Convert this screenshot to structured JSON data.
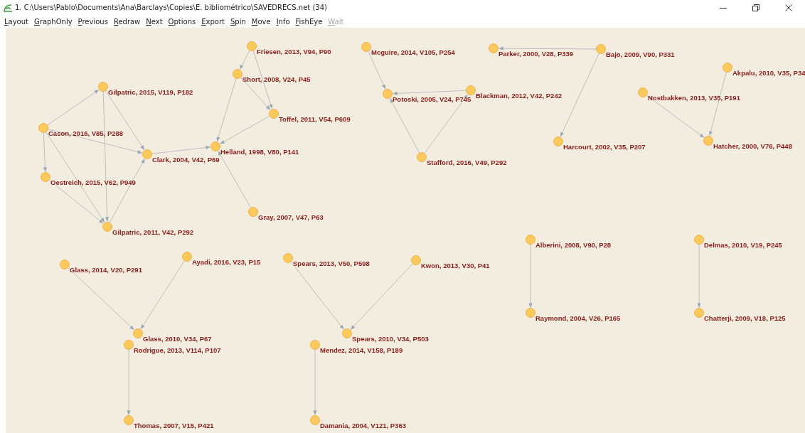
{
  "window": {
    "title": "1. C:\\Users\\Pablo\\Documents\\Ana\\Barclays\\Copies\\E. bibliométrico\\SAVEDRECS.net (34)"
  },
  "menu": [
    {
      "label": "Layout",
      "disabled": false
    },
    {
      "label": "GraphOnly",
      "disabled": false
    },
    {
      "label": "Previous",
      "disabled": false
    },
    {
      "label": "Redraw",
      "disabled": false
    },
    {
      "label": "Next",
      "disabled": false
    },
    {
      "label": "Options",
      "disabled": false
    },
    {
      "label": "Export",
      "disabled": false
    },
    {
      "label": "Spin",
      "disabled": false
    },
    {
      "label": "Move",
      "disabled": false
    },
    {
      "label": "Info",
      "disabled": false
    },
    {
      "label": "FishEye",
      "disabled": false
    },
    {
      "label": "Wait",
      "disabled": true
    }
  ],
  "graph": {
    "nodes": [
      {
        "label": "Friesen, 2013, V94, P90"
      },
      {
        "label": "Short, 2008, V24, P45"
      },
      {
        "label": "Gilpatric, 2015, V119, P182"
      },
      {
        "label": "Toffel, 2011, V54, P609"
      },
      {
        "label": "Cason, 2016, V85, P288"
      },
      {
        "label": "Clark, 2004, V42, P69"
      },
      {
        "label": "Helland, 1998, V80, P141"
      },
      {
        "label": "Oestreich, 2015, V62, P949"
      },
      {
        "label": "Gray, 2007, V47, P63"
      },
      {
        "label": "Gilpatric, 2011, V42, P292"
      },
      {
        "label": "Mcguire, 2014, V105, P254"
      },
      {
        "label": "Parker, 2000, V28, P339"
      },
      {
        "label": "Bajo, 2009, V90, P331"
      },
      {
        "label": "Akpalu, 2010, V35, P34"
      },
      {
        "label": "Potoski, 2005, V24, P745"
      },
      {
        "label": "Blackman, 2012, V42, P242"
      },
      {
        "label": "Nostbakken, 2013, V35, P191"
      },
      {
        "label": "Harcourt, 2002, V35, P207"
      },
      {
        "label": "Hatcher, 2000, V76, P448"
      },
      {
        "label": "Stafford, 2016, V49, P292"
      },
      {
        "label": "Alberini, 2008, V90, P28"
      },
      {
        "label": "Delmas, 2010, V19, P245"
      },
      {
        "label": "Glass, 2014, V20, P291"
      },
      {
        "label": "Ayadi, 2016, V23, P15"
      },
      {
        "label": "Spears, 2013, V50, P598"
      },
      {
        "label": "Kwon, 2013, V30, P41"
      },
      {
        "label": "Raymond, 2004, V26, P165"
      },
      {
        "label": "Chatterji, 2009, V18, P125"
      },
      {
        "label": "Glass, 2010, V34, P67"
      },
      {
        "label": "Spears, 2010, V34, P503"
      },
      {
        "label": "Rodrigue, 2013, V114, P107"
      },
      {
        "label": "Mendez, 2014, V158, P189"
      },
      {
        "label": "Thomas, 2007, V15, P421"
      },
      {
        "label": "Damania, 2004, V121, P363"
      }
    ]
  }
}
